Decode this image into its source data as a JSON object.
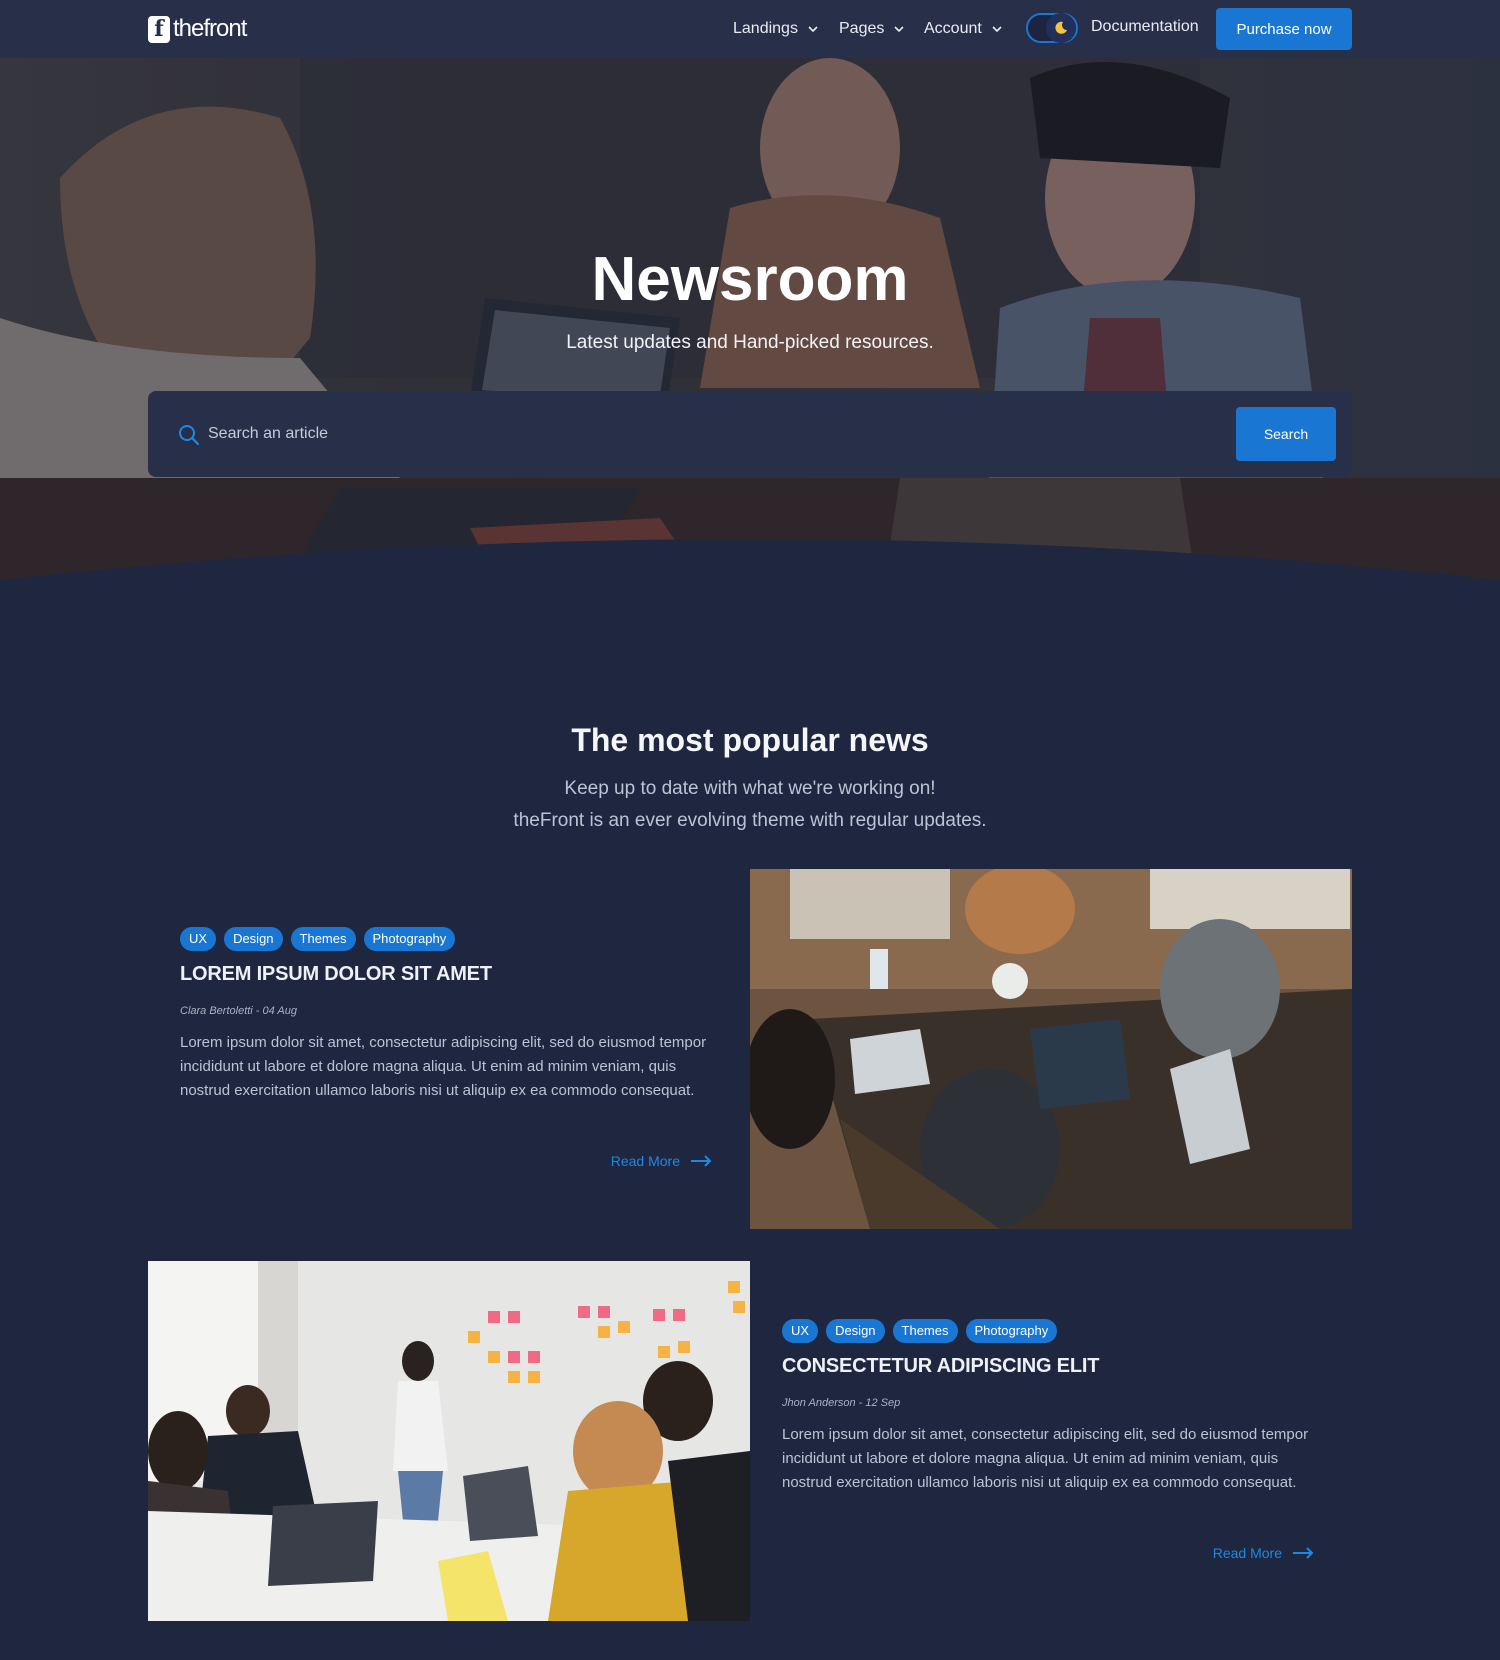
{
  "brand": {
    "logo_letter": "f",
    "name": "thefront"
  },
  "nav": {
    "items": [
      {
        "label": "Landings"
      },
      {
        "label": "Pages"
      },
      {
        "label": "Account"
      }
    ],
    "theme_toggle_icon": "moon-icon",
    "documentation": "Documentation",
    "purchase": "Purchase now"
  },
  "hero": {
    "title": "Newsroom",
    "subtitle": "Latest updates and Hand-picked resources.",
    "search_placeholder": "Search an article",
    "search_button": "Search"
  },
  "section": {
    "title": "The most popular news",
    "subtitle_line1": "Keep up to date with what we're working on!",
    "subtitle_line2": "theFront is an ever evolving theme with regular updates."
  },
  "articles": [
    {
      "tags": [
        "UX",
        "Design",
        "Themes",
        "Photography"
      ],
      "title": "LOREM IPSUM DOLOR SIT AMET",
      "meta": "Clara Bertoletti - 04 Aug",
      "text": "Lorem ipsum dolor sit amet, consectetur adipiscing elit, sed do eiusmod tempor incididunt ut labore et dolore magna aliqua. Ut enim ad minim veniam, quis nostrud exercitation ullamco laboris nisi ut aliquip ex ea commodo consequat.",
      "read_more": "Read More"
    },
    {
      "tags": [
        "UX",
        "Design",
        "Themes",
        "Photography"
      ],
      "title": "CONSECTETUR ADIPISCING ELIT",
      "meta": "Jhon Anderson - 12 Sep",
      "text": "Lorem ipsum dolor sit amet, consectetur adipiscing elit, sed do eiusmod tempor incididunt ut labore et dolore magna aliqua. Ut enim ad minim veniam, quis nostrud exercitation ullamco laboris nisi ut aliquip ex ea commodo consequat.",
      "read_more": "Read More"
    }
  ],
  "colors": {
    "background": "#1f2640",
    "navbar": "#272f49",
    "accent": "#1976d2",
    "link": "#1e88e5"
  }
}
